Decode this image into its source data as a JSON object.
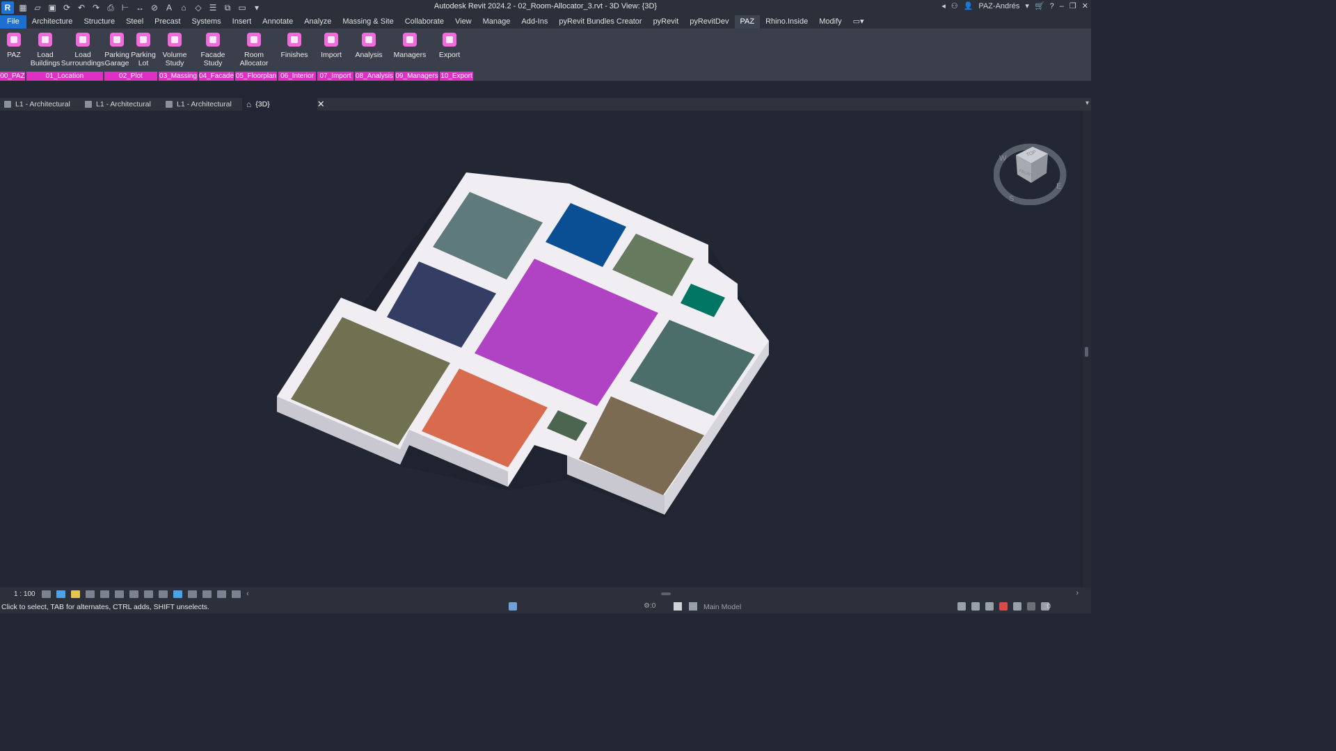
{
  "app": {
    "logo": "R",
    "title": "Autodesk Revit 2024.2 - 02_Room-Allocator_3.rvt - 3D View: {3D}",
    "user": "PAZ-Andrés"
  },
  "menu": [
    "File",
    "Architecture",
    "Structure",
    "Steel",
    "Precast",
    "Systems",
    "Insert",
    "Annotate",
    "Analyze",
    "Massing & Site",
    "Collaborate",
    "View",
    "Manage",
    "Add-Ins",
    "pyRevit Bundles Creator",
    "pyRevit",
    "pyRevitDev",
    "PAZ",
    "Rhino.Inside",
    "Modify"
  ],
  "ribbon": {
    "buttons": [
      {
        "label": "PAZ",
        "icon": "paz-logo-icon"
      },
      {
        "label": "Load\nBuildings",
        "icon": "buildings-icon"
      },
      {
        "label": "Load\nSurroundings",
        "icon": "surroundings-icon"
      },
      {
        "label": "Parking\nGarage",
        "icon": "parking-garage-icon"
      },
      {
        "label": "Parking\nLot",
        "icon": "parking-lot-icon"
      },
      {
        "label": "Volume\nStudy",
        "icon": "volume-study-icon"
      },
      {
        "label": "Facade\nStudy",
        "icon": "facade-study-icon"
      },
      {
        "label": "Room\nAllocator",
        "icon": "room-allocator-icon"
      },
      {
        "label": "Finishes",
        "icon": "finishes-icon"
      },
      {
        "label": "Import",
        "icon": "import-arrow-icon"
      },
      {
        "label": "Analysis",
        "icon": "analysis-chart-icon"
      },
      {
        "label": "Managers",
        "icon": "managers-icon"
      },
      {
        "label": "Export",
        "icon": "export-arrow-icon"
      }
    ],
    "panels": [
      "00_PAZ",
      "01_Location",
      "02_Plot",
      "03_Massing",
      "04_Facade",
      "05_Floorplan",
      "06_Interior",
      "07_Import",
      "08_Analysis",
      "09_Managers",
      "10_Export"
    ]
  },
  "view_tabs": [
    {
      "label": "L1 - Architectural"
    },
    {
      "label": "L1 - Architectural"
    },
    {
      "label": "L1 - Architectural"
    },
    {
      "label": "{3D}"
    }
  ],
  "viewcube": {
    "top": "TOP",
    "front": "FRONT",
    "w": "W",
    "s": "S",
    "e": "E"
  },
  "viewbar": {
    "scale": "1 : 100"
  },
  "status": {
    "text": "Click to select, TAB for alternates, CTRL adds, SHIFT unselects.",
    "count": ":0",
    "model": "Main Model",
    "filter": ":0"
  },
  "rooms_colors": {
    "magenta": "#b043c4",
    "orange": "#d86b4e",
    "olive": "#6f7150",
    "slate": "#5f7a7c",
    "blue": "#0a4f94",
    "navy": "#343d63",
    "sage": "#667a5e",
    "teal": "#007563",
    "teal_gray": "#4b6e6a",
    "brown": "#7b6b52",
    "small_green": "#4c6550"
  }
}
